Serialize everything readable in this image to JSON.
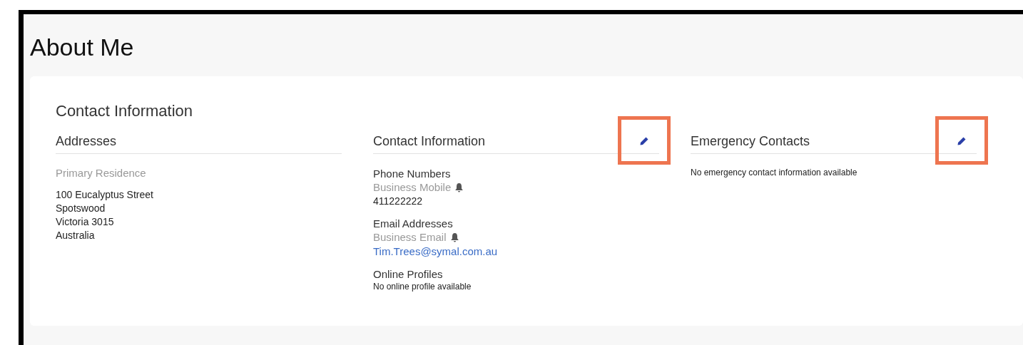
{
  "page_title": "About Me",
  "card": {
    "title": "Contact Information",
    "columns": [
      {
        "heading": "Addresses",
        "editable": false,
        "highlighted": false,
        "groups": [
          {
            "items": [
              {
                "kind": "caption",
                "text": "Primary Residence"
              }
            ]
          },
          {
            "items": [
              {
                "kind": "value",
                "text": "100 Eucalyptus Street"
              },
              {
                "kind": "value",
                "text": "Spotswood"
              },
              {
                "kind": "value",
                "text": "Victoria 3015"
              },
              {
                "kind": "value",
                "text": "Australia"
              }
            ]
          }
        ]
      },
      {
        "heading": "Contact Information",
        "editable": true,
        "highlighted": true,
        "groups": [
          {
            "items": [
              {
                "kind": "title",
                "text": "Phone Numbers"
              },
              {
                "kind": "label",
                "text": "Business Mobile",
                "alert": true
              },
              {
                "kind": "value",
                "text": "411222222"
              }
            ]
          },
          {
            "items": [
              {
                "kind": "title",
                "text": "Email Addresses"
              },
              {
                "kind": "label",
                "text": "Business Email",
                "alert": true
              },
              {
                "kind": "link",
                "text": "Tim.Trees@symal.com.au"
              }
            ]
          },
          {
            "items": [
              {
                "kind": "title",
                "text": "Online Profiles"
              },
              {
                "kind": "note",
                "text": "No online profile available"
              }
            ]
          }
        ]
      },
      {
        "heading": "Emergency Contacts",
        "editable": true,
        "highlighted": true,
        "groups": [
          {
            "items": [
              {
                "kind": "note",
                "text": "No emergency contact information available"
              }
            ]
          }
        ]
      }
    ]
  }
}
